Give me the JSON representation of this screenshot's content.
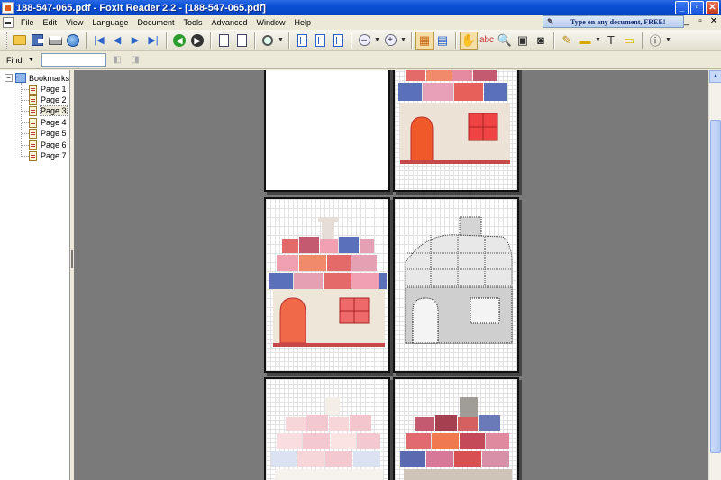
{
  "window": {
    "title": "188-547-065.pdf - Foxit Reader 2.2 - [188-547-065.pdf]"
  },
  "menu": {
    "items": [
      "File",
      "Edit",
      "View",
      "Language",
      "Document",
      "Tools",
      "Advanced",
      "Window",
      "Help"
    ]
  },
  "promo": {
    "text": "Type on any document, FREE!"
  },
  "toolbar": {
    "icons": [
      "open-icon",
      "save-icon",
      "print-icon",
      "globe-icon",
      "first-page-icon",
      "prev-page-icon",
      "next-page-icon",
      "last-page-icon",
      "go-back-icon",
      "go-forward-icon",
      "rotate-left-icon",
      "rotate-right-icon",
      "zoom-icon",
      "single-page-icon",
      "continuous-icon",
      "facing-icon",
      "zoom-out-icon",
      "zoom-in-icon",
      "bookmark-panel-icon",
      "thumbnail-panel-icon",
      "hand-tool-icon",
      "text-select-icon",
      "search-icon",
      "snapshot-icon",
      "camera-icon",
      "edit-icon",
      "highlight-icon",
      "typewriter-icon",
      "comment-icon",
      "info-icon"
    ]
  },
  "find": {
    "label": "Find:",
    "value": ""
  },
  "bookmarks": {
    "root": "Bookmarks",
    "items": [
      "Page 1",
      "Page 2",
      "Page 3",
      "Page 4",
      "Page 5",
      "Page 6",
      "Page 7"
    ],
    "selected": "Page 3"
  },
  "colors": {
    "titlebar": "#0a4fd4",
    "viewport": "#7a7a7a",
    "roof_red": "#e0625a",
    "roof_blue": "#5a78c0",
    "roof_pink": "#e6a0b4",
    "door": "#ee5a2a"
  }
}
